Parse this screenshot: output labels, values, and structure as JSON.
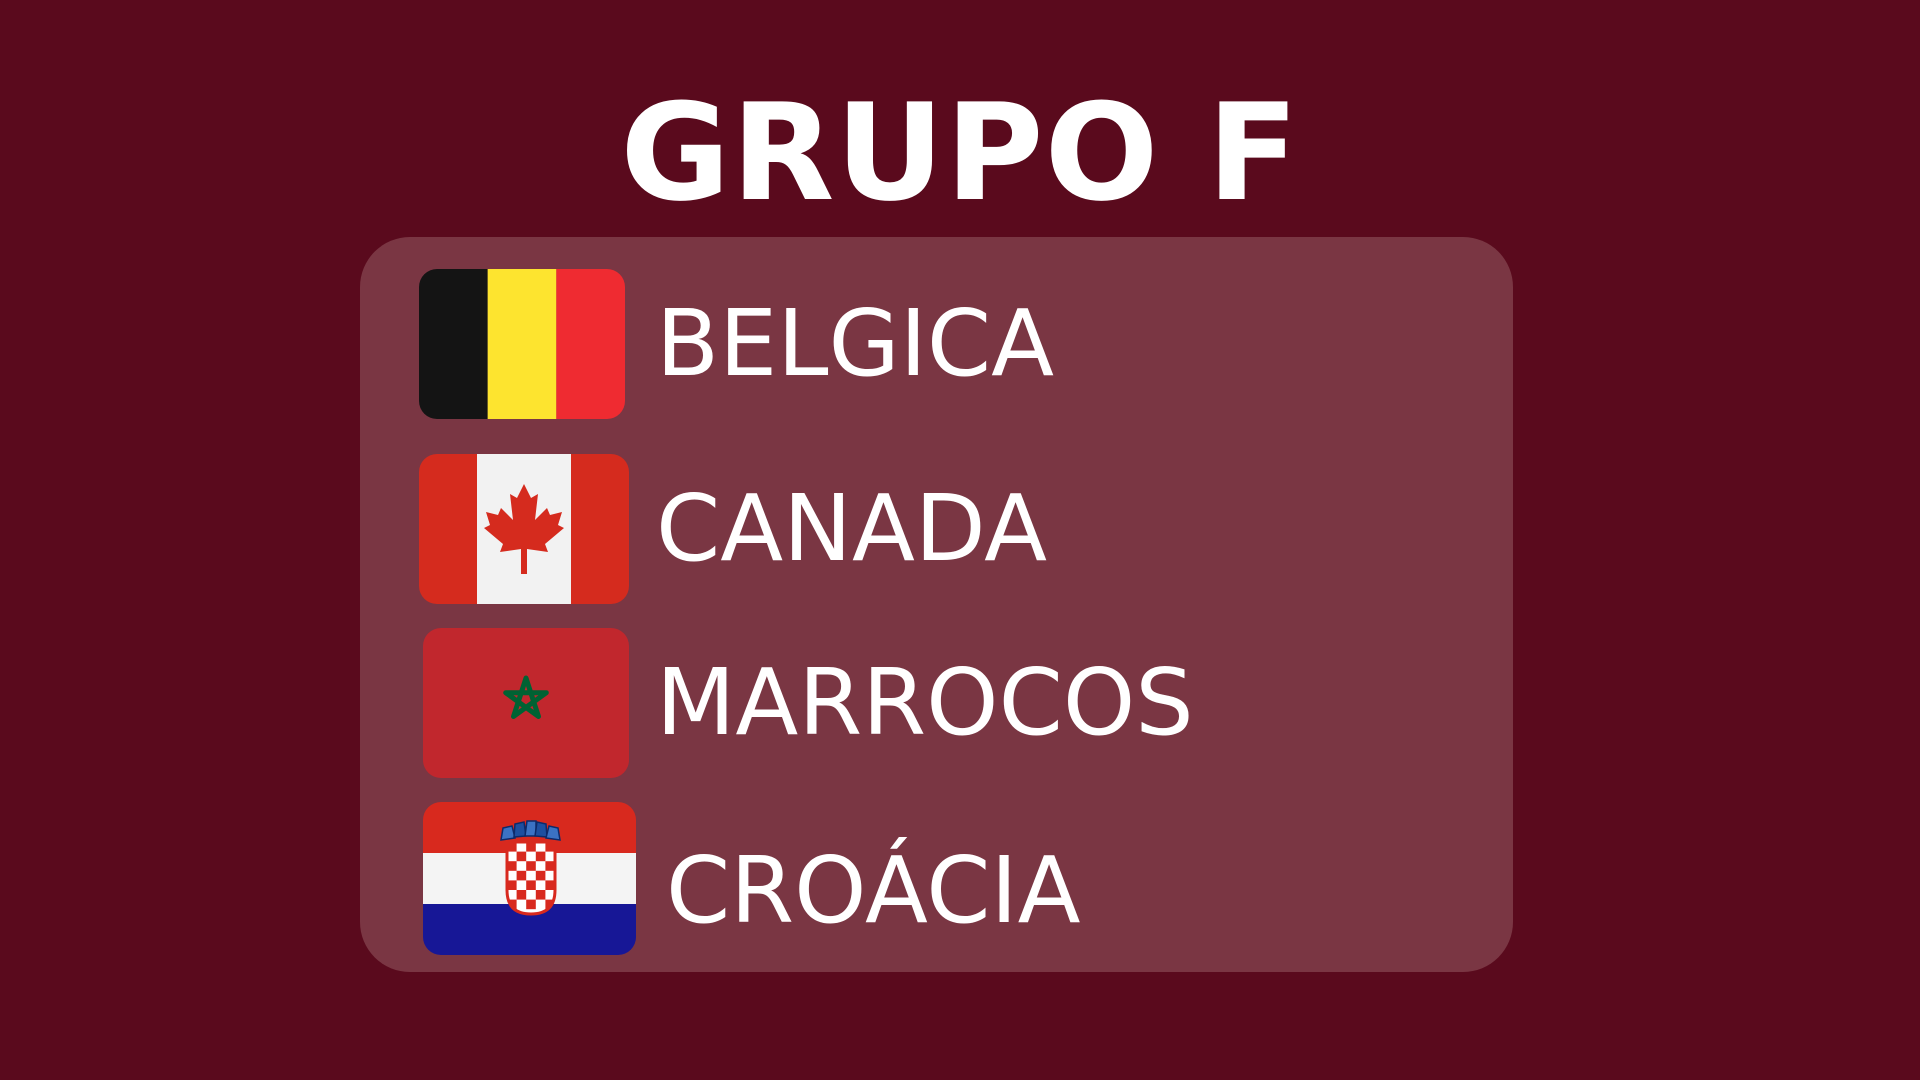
{
  "title": "GRUPO F",
  "colors": {
    "background": "#5a0a1d",
    "panel": "#7a3643",
    "text": "#ffffff"
  },
  "teams": [
    {
      "name": "BELGICA",
      "flag_icon": "belgium-flag-icon"
    },
    {
      "name": "CANADA",
      "flag_icon": "canada-flag-icon"
    },
    {
      "name": "MARROCOS",
      "flag_icon": "morocco-flag-icon"
    },
    {
      "name": "CROÁCIA",
      "flag_icon": "croatia-flag-icon"
    }
  ]
}
